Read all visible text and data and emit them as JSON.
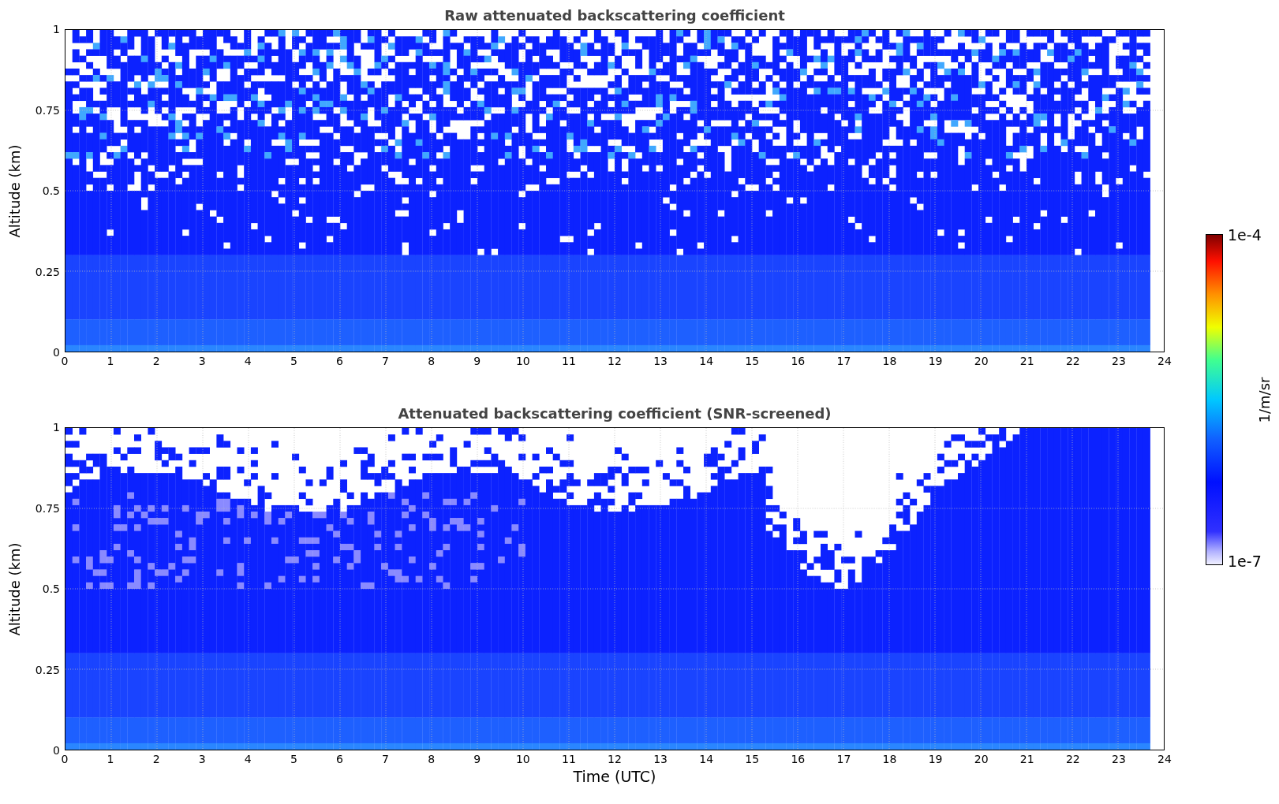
{
  "figure": {
    "panels": [
      {
        "kind": "raw",
        "title": "Raw attenuated backscattering coefficient",
        "ylabel": "Altitude (km)",
        "yticks": [
          "1",
          "0.75",
          "0.5",
          "0.25",
          "0"
        ],
        "xticks": [
          "0",
          "1",
          "2",
          "3",
          "4",
          "5",
          "6",
          "7",
          "8",
          "9",
          "10",
          "11",
          "12",
          "13",
          "14",
          "15",
          "16",
          "17",
          "18",
          "19",
          "20",
          "21",
          "22",
          "23",
          "24"
        ]
      },
      {
        "kind": "screened",
        "title": "Attenuated backscattering coefficient (SNR-screened)",
        "ylabel": "Altitude (km)",
        "yticks": [
          "1",
          "0.75",
          "0.5",
          "0.25",
          "0"
        ],
        "xticks": [
          "0",
          "1",
          "2",
          "3",
          "4",
          "5",
          "6",
          "7",
          "8",
          "9",
          "10",
          "11",
          "12",
          "13",
          "14",
          "15",
          "16",
          "17",
          "18",
          "19",
          "20",
          "21",
          "22",
          "23",
          "24"
        ],
        "xlabel": "Time (UTC)"
      }
    ],
    "colorbar": {
      "label": "1/m/sr",
      "max_label": "1e-4",
      "min_label": "1e-7"
    }
  }
}
